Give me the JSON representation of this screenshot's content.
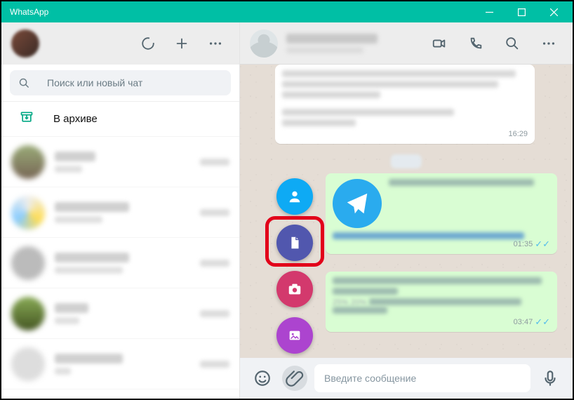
{
  "window": {
    "title": "WhatsApp"
  },
  "sidebar": {
    "search_placeholder": "Поиск или новый чат",
    "archive_label": "В архиве"
  },
  "attach_menu": {
    "contact": "contact-icon",
    "document": "document-icon",
    "camera": "camera-icon",
    "gallery": "gallery-icon"
  },
  "composer": {
    "placeholder": "Введите сообщение"
  },
  "messages": {
    "incoming1_time": "16:29",
    "out1_time": "01:35",
    "out2_time": "03:47",
    "pct_a": "25%",
    "pct_b": "20%"
  },
  "colors": {
    "accent": "#00bfa5",
    "highlight": "#e2001a",
    "telegram": "#2aabee"
  }
}
